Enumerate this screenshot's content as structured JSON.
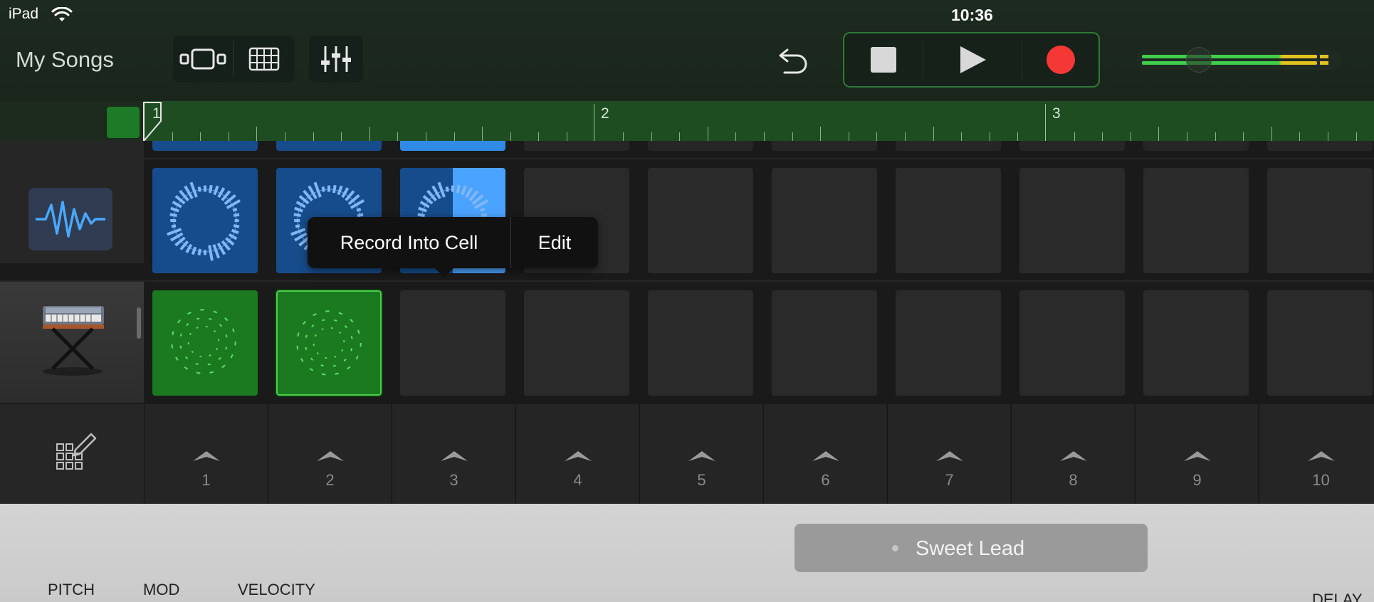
{
  "status": {
    "device": "iPad",
    "time": "10:36"
  },
  "toolbar": {
    "back_label": "My Songs",
    "view_icons": [
      "tracks-view-icon",
      "live-loops-grid-icon"
    ],
    "mixer_icon": "mixer-sliders-icon",
    "undo_icon": "undo-icon",
    "transport_icons": [
      "stop-icon",
      "play-icon",
      "record-icon"
    ],
    "record_color": "#f53836",
    "meter_colors": [
      "#3fcf4a",
      "#e3c21e"
    ]
  },
  "ruler": {
    "markers": [
      "1",
      "2",
      "3"
    ]
  },
  "tracks": [
    {
      "name": "audio",
      "icon": "waveform-icon",
      "cells": [
        "blue",
        "blue",
        "blue-split",
        "empty",
        "empty",
        "empty",
        "empty",
        "empty",
        "empty",
        "empty"
      ]
    },
    {
      "name": "keyboard",
      "icon": "keyboard-instrument-icon",
      "cells": [
        "green",
        "green-selected",
        "empty",
        "empty",
        "empty",
        "empty",
        "empty",
        "empty",
        "empty",
        "empty"
      ]
    }
  ],
  "popup": {
    "record_into_cell": "Record Into Cell",
    "edit": "Edit"
  },
  "scenes": [
    "1",
    "2",
    "3",
    "4",
    "5",
    "6",
    "7",
    "8",
    "9",
    "10"
  ],
  "scene_edit_icon": "edit-grid-icon",
  "panel": {
    "patch_name": "Sweet Lead",
    "labels": [
      "PITCH",
      "MOD",
      "VELOCITY",
      "DELAY"
    ]
  }
}
